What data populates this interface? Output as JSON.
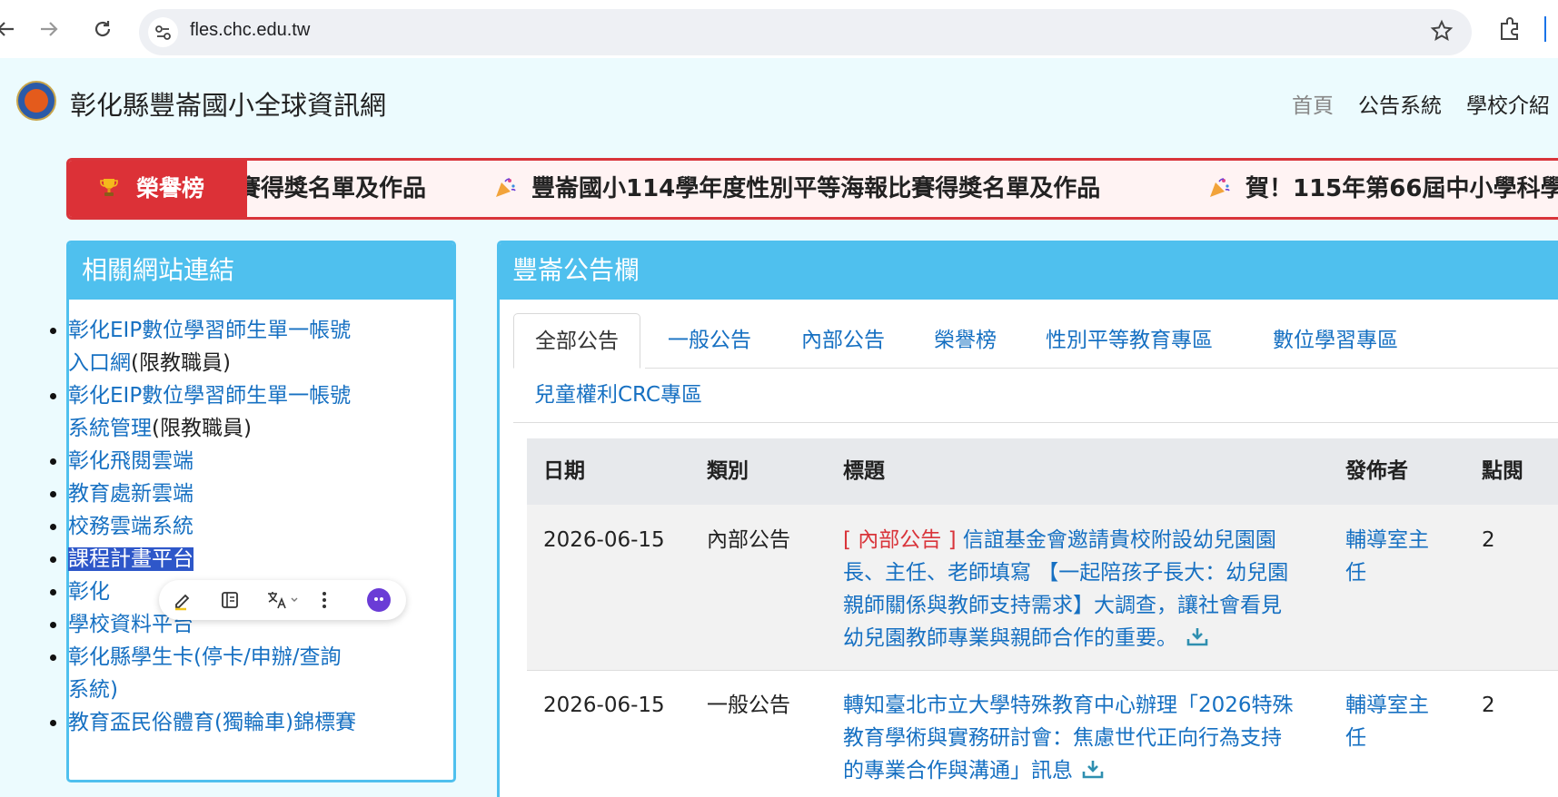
{
  "browser": {
    "url": "fles.chc.edu.tw",
    "back_icon": "arrow-left-icon",
    "forward_icon": "arrow-right-icon",
    "reload_icon": "reload-icon",
    "bookmark_icon": "star-icon",
    "extensions_icon": "puzzle-icon"
  },
  "site": {
    "title": "彰化縣豐崙國小全球資訊網",
    "nav": [
      "首頁",
      "公告系統",
      "學校介紹"
    ]
  },
  "honor_bar": {
    "label": "榮譽榜",
    "items": [
      "賽得獎名單及作品",
      "豐崙國小114學年度性別平等海報比賽得獎名單及作品",
      "賀！115年第66屆中小學科學"
    ]
  },
  "links_panel": {
    "title": "相關網站連結",
    "items": [
      {
        "line1": "彰化EIP數位學習師生單一帳號",
        "line2_link": "入口網",
        "note": "(限教職員)"
      },
      {
        "line1": "彰化EIP數位學習師生單一帳號",
        "line2_link": "系統管理",
        "note": "(限教職員)"
      },
      {
        "text": "彰化飛閱雲端"
      },
      {
        "text": "教育處新雲端"
      },
      {
        "text": "校務雲端系統"
      },
      {
        "text": "課程計畫平台"
      },
      {
        "text": "彰化"
      },
      {
        "text": "學校資料平台"
      },
      {
        "line1": "彰化縣學生卡(停卡/申辦/查詢",
        "line2": "系統)"
      },
      {
        "text": "教育盃民俗體育(獨輪車)錦標賽"
      }
    ]
  },
  "selection_toolbar": {
    "icons": [
      "pencil-icon",
      "notes-icon",
      "translate-icon",
      "more-icon",
      "assistant-icon"
    ]
  },
  "announce_panel": {
    "title": "豐崙公告欄",
    "tabs": [
      "全部公告",
      "一般公告",
      "內部公告",
      "榮譽榜",
      "性別平等教育專區",
      "數位學習專區",
      "兒童權利CRC專區"
    ],
    "columns": [
      "日期",
      "類別",
      "標題",
      "發佈者",
      "點閱"
    ],
    "rows": [
      {
        "date": "2026-06-15",
        "category": "內部公告",
        "tag": "[ 內部公告 ]",
        "title_lines": [
          "信誼基金會邀請貴校附設幼兒園園",
          "長、主任、老師填寫 【一起陪孩子長大：幼兒園",
          "親師關係與教師支持需求】大調查，讓社會看見",
          "幼兒園教師專業與親師合作的重要。"
        ],
        "publisher_lines": [
          "輔導室主",
          "任"
        ],
        "views": "2"
      },
      {
        "date": "2026-06-15",
        "category": "一般公告",
        "tag": "",
        "title_lines": [
          "轉知臺北市立大學特殊教育中心辦理「2026特殊",
          "教育學術與實務研討會：焦慮世代正向行為支持",
          "的專業合作與溝通」訊息"
        ],
        "publisher_lines": [
          "輔導室主",
          "任"
        ],
        "views": "2"
      }
    ]
  },
  "colors": {
    "accent": "#4fc0ee",
    "link": "#1670c2",
    "honor_red": "#dc3137",
    "page_bg": "#ecfbfe"
  }
}
